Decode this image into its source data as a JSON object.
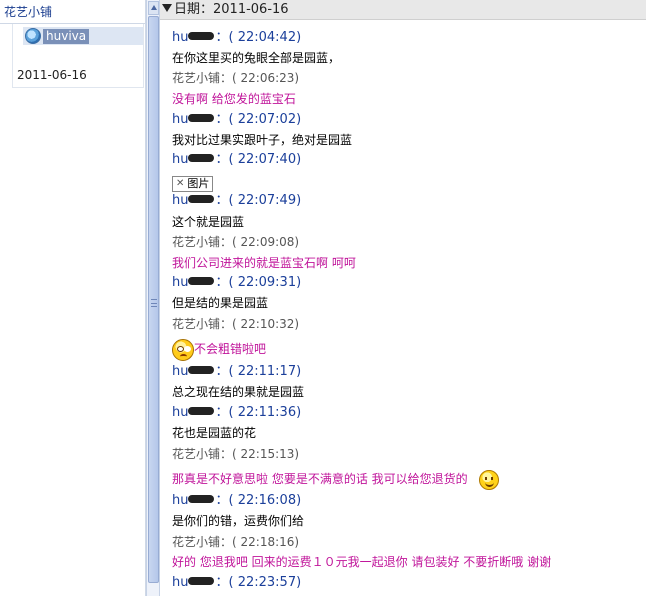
{
  "sidebar": {
    "title": "花艺小铺",
    "contact_name": "huviva",
    "date": "2011-06-16"
  },
  "chat_header": {
    "label": "日期：2011-06-16"
  },
  "messages": [
    {
      "sender": "hu",
      "sender_suffix": "：",
      "time": "( 22:04:42)",
      "self": true,
      "text": "在你这里买的兔眼全部是园蓝，"
    },
    {
      "sender": "花艺小铺",
      "sender_suffix": "：",
      "time": "( 22:06:23)",
      "self": false,
      "text": "没有啊 给您发的蓝宝石"
    },
    {
      "sender": "hu",
      "sender_suffix": "：",
      "time": "( 22:07:02)",
      "self": true,
      "text": "我对比过果实跟叶子，绝对是园蓝"
    },
    {
      "sender": "hu",
      "sender_suffix": "：",
      "time": "( 22:07:40)",
      "self": true,
      "text": "图片"
    },
    {
      "sender": "hu",
      "sender_suffix": "：",
      "time": "( 22:07:49)",
      "self": true,
      "text": "这个就是园蓝"
    },
    {
      "sender": "花艺小铺",
      "sender_suffix": "：",
      "time": "( 22:09:08)",
      "self": false,
      "text": "我们公司进来的就是蓝宝石啊   呵呵"
    },
    {
      "sender": "hu",
      "sender_suffix": "：",
      "time": "( 22:09:31)",
      "self": true,
      "text": "但是结的果是园蓝"
    },
    {
      "sender": "花艺小铺",
      "sender_suffix": "：",
      "time": "( 22:10:32)",
      "self": false,
      "text": "不会粗错啦吧"
    },
    {
      "sender": "hu",
      "sender_suffix": "：",
      "time": "( 22:11:17)",
      "self": true,
      "text": "总之现在结的果就是园蓝"
    },
    {
      "sender": "hu",
      "sender_suffix": "：",
      "time": "( 22:11:36)",
      "self": true,
      "text": "花也是园蓝的花"
    },
    {
      "sender": "花艺小铺",
      "sender_suffix": "：",
      "time": "( 22:15:13)",
      "self": false,
      "text": "那真是不好意思啦      您要是不满意的话   我可以给您退货的"
    },
    {
      "sender": "hu",
      "sender_suffix": "：",
      "time": "( 22:16:08)",
      "self": true,
      "text": "是你们的错，运费你们给"
    },
    {
      "sender": "花艺小铺",
      "sender_suffix": "：",
      "time": "( 22:18:16)",
      "self": false,
      "text": "好的      您退我吧   回来的运费１０元我一起退你      请包装好   不要折断哦      谢谢"
    },
    {
      "sender": "hu",
      "sender_suffix": "：",
      "time": "( 22:23:57)",
      "self": true,
      "text": ""
    }
  ],
  "icons": {
    "avatar": "user-avatar-icon",
    "image_placeholder": "broken-image-icon",
    "worried_emoticon": "worried-face-icon",
    "smile_emoticon": "smile-face-icon"
  }
}
